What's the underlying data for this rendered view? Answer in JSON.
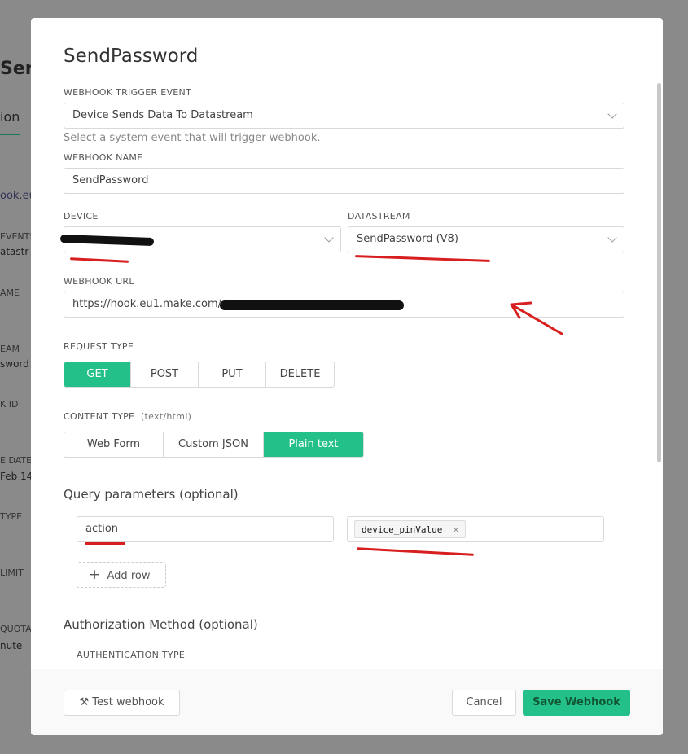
{
  "background": {
    "title": "Sen",
    "tab": "ion",
    "items": [
      "ook.eu",
      "EVENTS",
      "atastr",
      "AME",
      "EAM",
      "sword",
      "K ID",
      "E DATE",
      "Feb 14",
      "TYPE",
      "LIMIT",
      "QUOTA",
      "nute"
    ]
  },
  "modal": {
    "title": "SendPassword",
    "trigger": {
      "label": "WEBHOOK TRIGGER EVENT",
      "value": "Device Sends Data To Datastream",
      "hint": "Select a system event that will trigger webhook."
    },
    "name": {
      "label": "WEBHOOK NAME",
      "value": "SendPassword"
    },
    "device": {
      "label": "DEVICE",
      "value": ""
    },
    "datastream": {
      "label": "DATASTREAM",
      "value": "SendPassword (V8)"
    },
    "url": {
      "label": "WEBHOOK URL",
      "value": "https://hook.eu1.make.com/"
    },
    "request_type": {
      "label": "REQUEST TYPE",
      "options": [
        "GET",
        "POST",
        "PUT",
        "DELETE"
      ],
      "selected": "GET"
    },
    "content_type": {
      "label": "CONTENT TYPE",
      "hint": "(text/html)",
      "options": [
        "Web Form",
        "Custom JSON",
        "Plain text"
      ],
      "selected": "Plain text"
    },
    "query": {
      "title": "Query parameters (optional)",
      "key": "action",
      "value_chip": "device_pinValue",
      "add_row": "Add row"
    },
    "auth": {
      "title": "Authorization Method (optional)",
      "label": "AUTHENTICATION TYPE"
    },
    "footer": {
      "test": "Test webhook",
      "cancel": "Cancel",
      "save": "Save Webhook"
    }
  },
  "colors": {
    "accent": "#23c08a",
    "annotation": "#d81f1f"
  }
}
